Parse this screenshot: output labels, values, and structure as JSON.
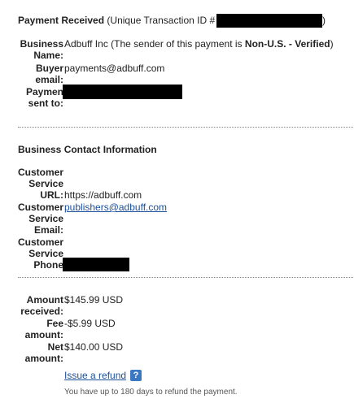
{
  "header": {
    "title": "Payment Received",
    "txn_prefix": "(Unique Transaction ID #",
    "txn_suffix": ")"
  },
  "details": {
    "business_name_label_1": "Business",
    "business_name_label_2": "Name:",
    "business_name_value": "Adbuff Inc (The sender of this payment is ",
    "business_status": "Non-U.S. - Verified",
    "business_name_end": ")",
    "buyer_email_label_1": "Buyer",
    "buyer_email_label_2": "email:",
    "buyer_email_value": "payments@adbuff.com",
    "payment_sent_label_1": "Paymen",
    "payment_sent_label_2": "sent to:"
  },
  "contact": {
    "heading": "Business Contact Information",
    "url_label_1": "Customer",
    "url_label_2": "Service",
    "url_label_3": "URL:",
    "url_value": "https://adbuff.com",
    "email_label_1": "Customer",
    "email_label_2": "Service",
    "email_label_3": "Email:",
    "email_value": "publishers@adbuff.com",
    "phone_label_1": "Customer",
    "phone_label_2": "Service",
    "phone_label_3": "Phone"
  },
  "amounts": {
    "received_label_1": "Amount",
    "received_label_2": "received:",
    "received_value": "$145.99 USD",
    "fee_label_1": "Fee",
    "fee_label_2": "amount:",
    "fee_value": "-$5.99 USD",
    "net_label_1": "Net",
    "net_label_2": "amount:",
    "net_value": "$140.00 USD"
  },
  "refund": {
    "link_label": "Issue a refund",
    "help_glyph": "?",
    "note": "You have up to 180 days to refund the payment."
  },
  "colors": {
    "link": "#1a4f9c",
    "redaction": "#000000",
    "help_icon": "#3a78c4"
  }
}
